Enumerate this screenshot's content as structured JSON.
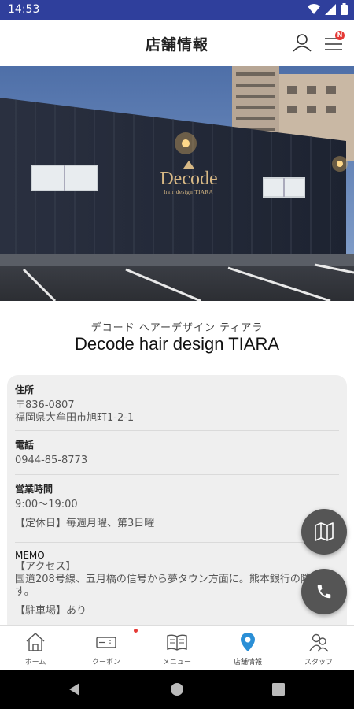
{
  "status_bar": {
    "time": "14:53"
  },
  "app_bar": {
    "title": "店舗情報",
    "badge": "N"
  },
  "shop": {
    "name_kana": "デコード ヘアーデザイン ティアラ",
    "name": "Decode hair design TIARA",
    "sign_main": "Decode",
    "sign_sub": "hair design TIARA"
  },
  "info": {
    "address_label": "住所",
    "postal": "〒836-0807",
    "address": "福岡県大牟田市旭町1-2-1",
    "phone_label": "電話",
    "phone": "0944-85-8773",
    "hours_label": "営業時間",
    "hours": "9:00～19:00",
    "holiday": "【定休日】毎週月曜、第3日曜",
    "memo_label": "MEMO",
    "memo_access_title": "【アクセス】",
    "memo_access": "国道208号線、五月橋の信号から夢タウン方面に。熊本銀行の隣に",
    "memo_access_cont": "す。",
    "memo_parking": "【駐車場】あり"
  },
  "bottom_nav": [
    {
      "label": "ホーム",
      "icon": "home-icon"
    },
    {
      "label": "クーポン",
      "icon": "coupon-icon"
    },
    {
      "label": "メニュー",
      "icon": "menu-book-icon"
    },
    {
      "label": "店舗情報",
      "icon": "location-pin-icon"
    },
    {
      "label": "スタッフ",
      "icon": "staff-icon"
    }
  ],
  "colors": {
    "status_bar": "#2f3f9c",
    "accent": "#2b8fd6",
    "fab": "#555555",
    "badge": "#e53935"
  }
}
